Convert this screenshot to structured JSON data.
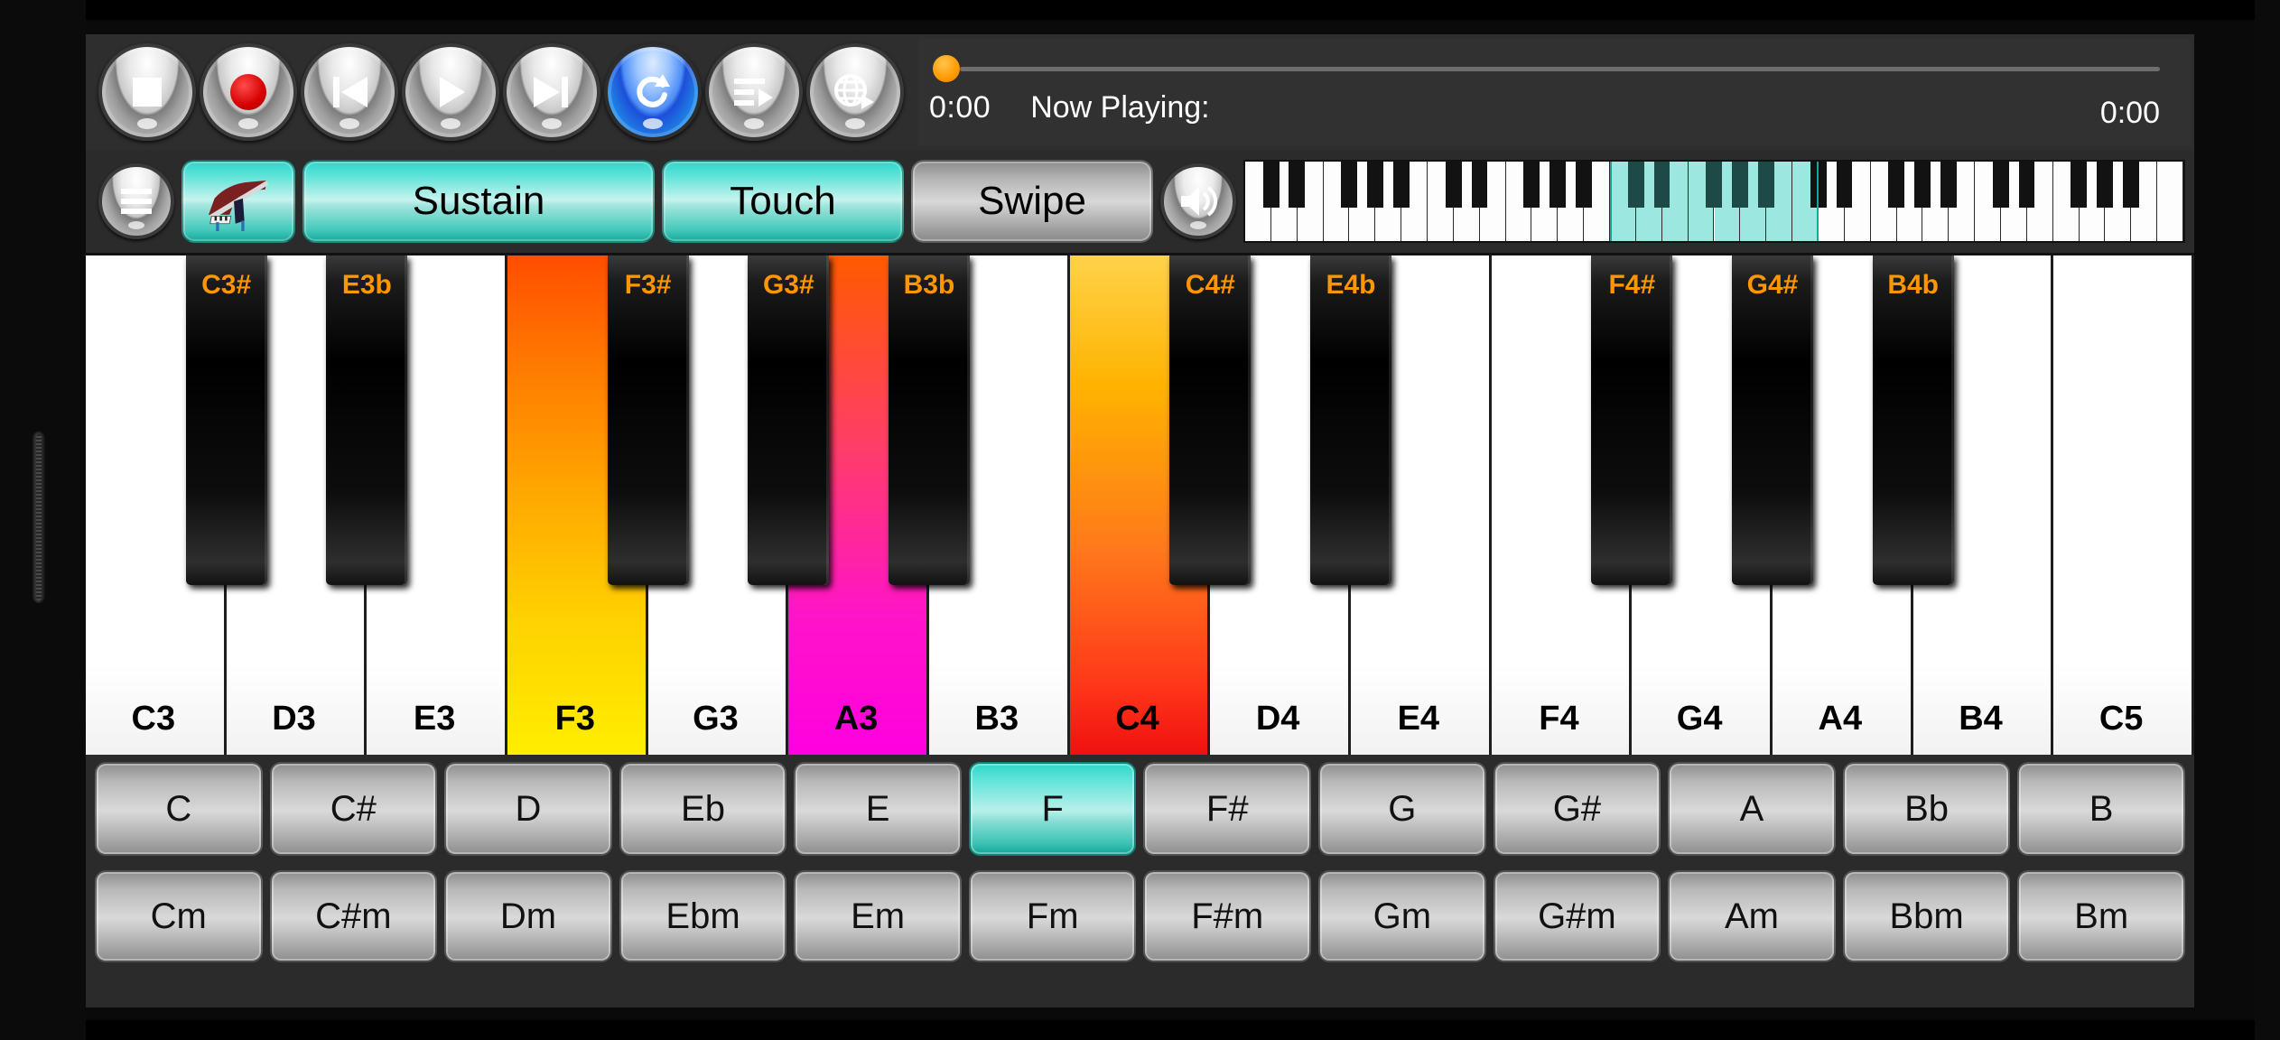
{
  "transport": {
    "buttons": [
      {
        "name": "stop-button",
        "icon": "stop-icon",
        "active": false
      },
      {
        "name": "record-button",
        "icon": "record-icon",
        "active": false
      },
      {
        "name": "previous-button",
        "icon": "previous-icon",
        "active": false
      },
      {
        "name": "play-button",
        "icon": "play-icon",
        "active": false
      },
      {
        "name": "next-button",
        "icon": "next-icon",
        "active": false
      },
      {
        "name": "loop-button",
        "icon": "loop-icon",
        "active": true
      },
      {
        "name": "playlist-button",
        "icon": "playlist-icon",
        "active": false
      },
      {
        "name": "globe-button",
        "icon": "globe-icon",
        "active": false
      }
    ]
  },
  "now_playing": {
    "time_current": "0:00",
    "time_total": "0:00",
    "label": "Now Playing:",
    "title": "",
    "progress_percent": 0,
    "handle_color": "#ff9800"
  },
  "controls": {
    "menu_icon": "hamburger-menu-icon",
    "instrument_icon": "grand-piano-icon",
    "instrument_active": true,
    "sustain_label": "Sustain",
    "sustain_active": true,
    "touch_label": "Touch",
    "touch_active": true,
    "swipe_label": "Swipe",
    "swipe_active": false,
    "volume_icon": "speaker-volume-icon",
    "accent_teal": "#2fd6c8",
    "inactive_gray": "#b5b5b5"
  },
  "mini_keyboard": {
    "total_white_keys": 36,
    "viewport_start_white_index": 14,
    "viewport_white_count": 8,
    "highlight_color": "#9ce8e0"
  },
  "piano": {
    "white_keys": [
      {
        "label": "C3",
        "state": "normal"
      },
      {
        "label": "D3",
        "state": "normal"
      },
      {
        "label": "E3",
        "state": "normal"
      },
      {
        "label": "F3",
        "state": "pressed-f3"
      },
      {
        "label": "G3",
        "state": "normal"
      },
      {
        "label": "A3",
        "state": "pressed-a3"
      },
      {
        "label": "B3",
        "state": "normal"
      },
      {
        "label": "C4",
        "state": "pressed-c4"
      },
      {
        "label": "D4",
        "state": "normal"
      },
      {
        "label": "E4",
        "state": "normal"
      },
      {
        "label": "F4",
        "state": "normal"
      },
      {
        "label": "G4",
        "state": "normal"
      },
      {
        "label": "A4",
        "state": "normal"
      },
      {
        "label": "B4",
        "state": "normal"
      },
      {
        "label": "C5",
        "state": "normal"
      }
    ],
    "black_keys": [
      {
        "label": "C3#",
        "after_white": 0,
        "pressed": false
      },
      {
        "label": "E3b",
        "after_white": 1,
        "pressed": false
      },
      {
        "label": "F3#",
        "after_white": 3,
        "pressed": false
      },
      {
        "label": "G3#",
        "after_white": 4,
        "pressed": false
      },
      {
        "label": "B3b",
        "after_white": 5,
        "pressed": false
      },
      {
        "label": "C4#",
        "after_white": 7,
        "pressed": false
      },
      {
        "label": "E4b",
        "after_white": 8,
        "pressed": false
      },
      {
        "label": "F4#",
        "after_white": 10,
        "pressed": false
      },
      {
        "label": "G4#",
        "after_white": 11,
        "pressed": false
      },
      {
        "label": "B4b",
        "after_white": 12,
        "pressed": false
      }
    ],
    "label_color": "#ff9500"
  },
  "chords": {
    "major": [
      {
        "label": "C",
        "selected": false
      },
      {
        "label": "C#",
        "selected": false
      },
      {
        "label": "D",
        "selected": false
      },
      {
        "label": "Eb",
        "selected": false
      },
      {
        "label": "E",
        "selected": false
      },
      {
        "label": "F",
        "selected": true
      },
      {
        "label": "F#",
        "selected": false
      },
      {
        "label": "G",
        "selected": false
      },
      {
        "label": "G#",
        "selected": false
      },
      {
        "label": "A",
        "selected": false
      },
      {
        "label": "Bb",
        "selected": false
      },
      {
        "label": "B",
        "selected": false
      }
    ],
    "minor": [
      {
        "label": "Cm",
        "selected": false
      },
      {
        "label": "C#m",
        "selected": false
      },
      {
        "label": "Dm",
        "selected": false
      },
      {
        "label": "Ebm",
        "selected": false
      },
      {
        "label": "Em",
        "selected": false
      },
      {
        "label": "Fm",
        "selected": false
      },
      {
        "label": "F#m",
        "selected": false
      },
      {
        "label": "Gm",
        "selected": false
      },
      {
        "label": "G#m",
        "selected": false
      },
      {
        "label": "Am",
        "selected": false
      },
      {
        "label": "Bbm",
        "selected": false
      },
      {
        "label": "Bm",
        "selected": false
      }
    ]
  }
}
